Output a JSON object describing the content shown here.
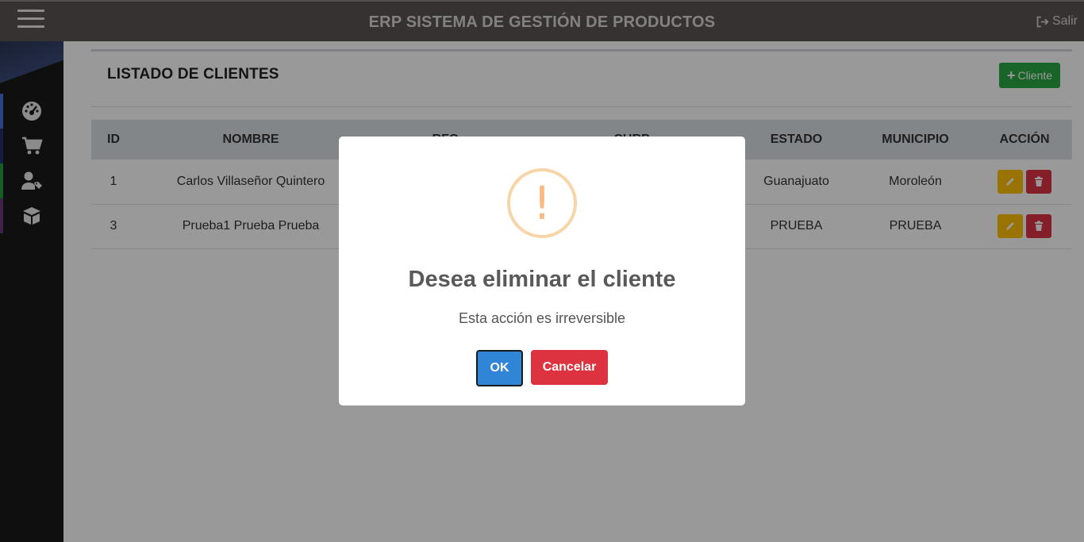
{
  "header": {
    "title": "ERP SISTEMA DE GESTIÓN DE PRODUCTOS",
    "logout_label": "Salir"
  },
  "sidebar": {
    "items": [
      {
        "icon": "dashboard-icon",
        "accent": "#4a6fdc"
      },
      {
        "icon": "cart-icon",
        "accent": "#27306d"
      },
      {
        "icon": "user-tag-icon",
        "accent": "#1f9d3b"
      },
      {
        "icon": "box-icon",
        "accent": "#6a3a7a"
      }
    ]
  },
  "page": {
    "title": "LISTADO DE CLIENTES",
    "add_button_label": "Cliente"
  },
  "table": {
    "columns": [
      "ID",
      "NOMBRE",
      "RFC",
      "CURP",
      "ESTADO",
      "MUNICIPIO",
      "ACCIÓN"
    ],
    "rows": [
      {
        "id": "1",
        "nombre": "Carlos Villaseñor Quintero",
        "estado": "Guanajuato",
        "municipio": "Moroleón"
      },
      {
        "id": "3",
        "nombre": "Prueba1 Prueba Prueba",
        "estado": "PRUEBA",
        "municipio": "PRUEBA"
      }
    ]
  },
  "modal": {
    "icon": "warning-icon",
    "title": "Desea eliminar el cliente",
    "text": "Esta acción es irreversible",
    "ok_label": "OK",
    "cancel_label": "Cancelar"
  },
  "colors": {
    "topbar": "#5b5452",
    "success": "#28a745",
    "warning": "#ffc107",
    "danger": "#dc3545",
    "primary": "#3085d6"
  }
}
